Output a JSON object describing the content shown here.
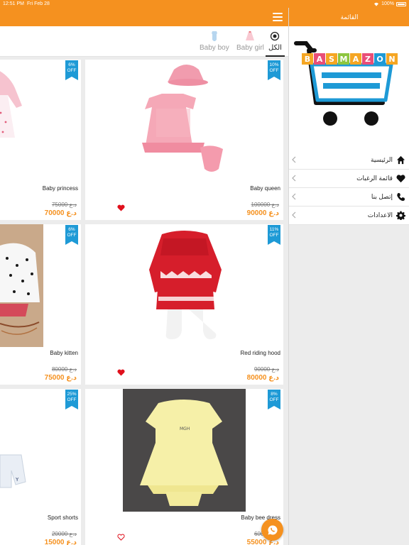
{
  "status": {
    "time": "12:51 PM",
    "date": "Fri Feb 28",
    "battery": "100%"
  },
  "tabs": [
    {
      "label": "الكل",
      "active": true,
      "icon": "target-icon"
    },
    {
      "label": "Baby girl",
      "active": false,
      "icon": "baby-girl-dress-icon"
    },
    {
      "label": "Baby boy",
      "active": false,
      "icon": "baby-boy-onesie-icon"
    }
  ],
  "products": [
    {
      "name": "Baby queen",
      "old_price": "100000 د.ع",
      "new_price": "90000 د.ع",
      "discount": "10%",
      "off": "OFF",
      "favorite": true
    },
    {
      "name": "Baby princess",
      "old_price": "75000 د.ع",
      "new_price": "70000 د.ع",
      "discount": "6%",
      "off": "OFF",
      "favorite": false
    },
    {
      "name": "Red riding hood",
      "old_price": "90000 د.ع",
      "new_price": "80000 د.ع",
      "discount": "11%",
      "off": "OFF",
      "favorite": true
    },
    {
      "name": "Baby kitten",
      "old_price": "80000 د.ع",
      "new_price": "75000 د.ع",
      "discount": "6%",
      "off": "OFF",
      "favorite": false
    },
    {
      "name": "Baby bee dress",
      "old_price": "60000 د.ع",
      "new_price": "55000 د.ع",
      "discount": "8%",
      "off": "OFF",
      "favorite": false
    },
    {
      "name": "Sport shorts",
      "old_price": "20000 د.ع",
      "new_price": "15000 د.ع",
      "discount": "25%",
      "off": "OFF",
      "favorite": false
    }
  ],
  "side_menu": {
    "title": "القائمة",
    "logo_text": "BASMAZON",
    "items": [
      {
        "label": "الرئيسية",
        "icon": "home-icon"
      },
      {
        "label": "قائمة الرغبات",
        "icon": "heart-icon"
      },
      {
        "label": "إتصل بنا",
        "icon": "phone-icon"
      },
      {
        "label": "الاعدادات",
        "icon": "gear-icon"
      }
    ]
  },
  "colors": {
    "accent": "#f5911f",
    "badge": "#1e9ad6",
    "heart": "#e0101c"
  }
}
